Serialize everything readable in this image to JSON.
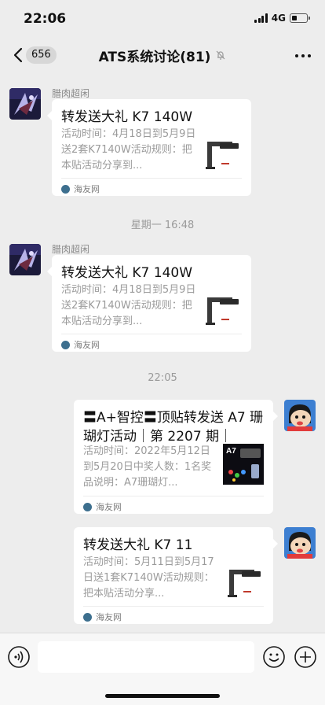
{
  "status_bar": {
    "time": "22:06",
    "network": "4G"
  },
  "nav": {
    "badge": "656",
    "title": "ATS系统讨论(81)"
  },
  "messages": [
    {
      "sender": "腊肉超闲",
      "title": "转发送大礼 K7 140W",
      "description": "活动时间：4月18日到5月9日送2套K7140W活动规则：把本贴活动分享到...",
      "source": "海友网"
    },
    {
      "timestamp": "星期一 16:48"
    },
    {
      "sender": "腊肉超闲",
      "title": "转发送大礼 K7 140W",
      "description": "活动时间：4月18日到5月9日送2套K7140W活动规则：把本贴活动分享到...",
      "source": "海友网"
    },
    {
      "timestamp": "22:05"
    },
    {
      "title": "〓A+智控〓顶贴转发送 A7 珊瑚灯活动｜第 2207 期｜",
      "description": "活动时间：2022年5月12日到5月20日中奖人数：1名奖品说明：A7珊瑚灯...",
      "thumb_label": "A7",
      "source": "海友网"
    },
    {
      "title": "转发送大礼 K7 11",
      "description": "活动时间：5月11日到5月17日送1套K7140W活动规则：把本贴活动分享...",
      "source": "海友网"
    }
  ],
  "colors": {
    "background": "#ededed",
    "card": "#ffffff",
    "meta_text": "#9b9b9b"
  },
  "icons": [
    "back-chevron-icon",
    "mute-icon",
    "more-icon",
    "voice-icon",
    "emoji-icon",
    "plus-icon",
    "source-icon"
  ]
}
